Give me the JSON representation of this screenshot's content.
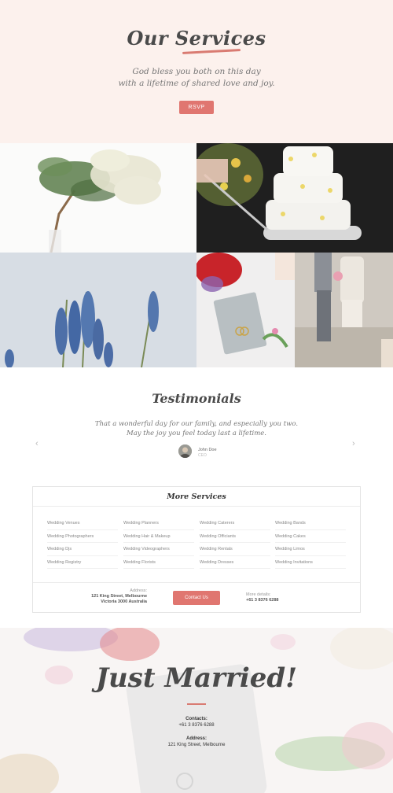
{
  "hero": {
    "title": "Our Services",
    "subtitle_lines": [
      "God bless you both on this day",
      "with a lifetime of shared love and joy."
    ],
    "rsvp_label": "RSVP"
  },
  "testimonials": {
    "title": "Testimonials",
    "quote_lines": [
      "That a wonderful day for our family, and especially you two.",
      "May the joy you feel today last a lifetime."
    ],
    "author_name": "John Doe",
    "author_role": "CEO",
    "prev_icon": "chevron-left-icon",
    "next_icon": "chevron-right-icon"
  },
  "more_services": {
    "title": "More Services",
    "columns": [
      [
        "Wedding Venues",
        "Wedding Photographers",
        "Wedding Djs",
        "Wedding Registry"
      ],
      [
        "Wedding Planners",
        "Wedding Hair & Makeup",
        "Wedding Videographers",
        "Wedding Florists"
      ],
      [
        "Wedding Caterers",
        "Wedding Officiants",
        "Wedding Rentals",
        "Wedding Dresses"
      ],
      [
        "Wedding Bands",
        "Wedding Cakes",
        "Wedding Limos",
        "Wedding Invitations"
      ]
    ],
    "address_label": "Address:",
    "address_line1": "121 King Street, Melbourne",
    "address_line2": "Victoria 3000 Australia",
    "contact_label": "Contact Us",
    "more_details_label": "More details:",
    "phone": "+61 3 8376 6288"
  },
  "footer": {
    "title": "Just Married!",
    "contacts_label": "Contacts:",
    "contacts_value": "+61 3 8376 6288",
    "address_label": "Address:",
    "address_value": "121 King Street, Melbourne"
  },
  "colors": {
    "accent": "#e07670",
    "hero_bg": "#fcf1ed",
    "text_dark": "#4a4a4a"
  }
}
